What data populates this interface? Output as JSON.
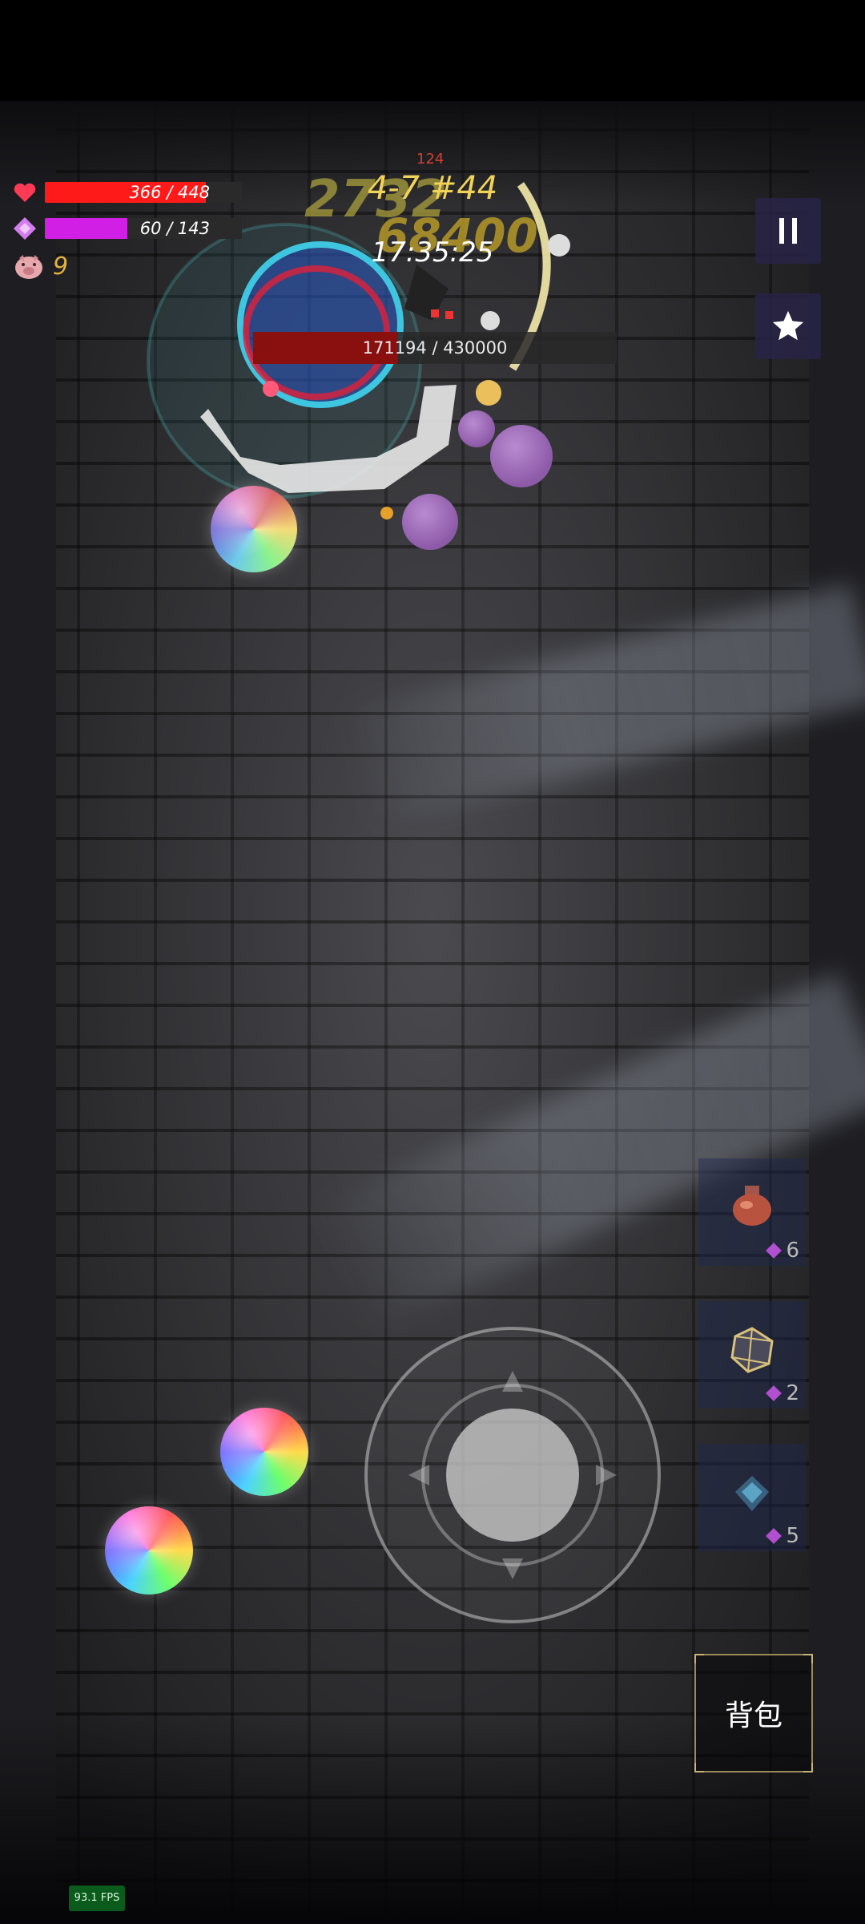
{
  "hud": {
    "hp": {
      "current": 366,
      "max": 448,
      "label": "366 / 448",
      "color": "#ff1a1a"
    },
    "mp": {
      "current": 60,
      "max": 143,
      "label": "60 / 143",
      "color": "#d21fe6"
    },
    "gold": "9"
  },
  "stage": {
    "label": "4-7 #44",
    "timer": "17:35:25"
  },
  "damage_numbers": {
    "primary": "2732",
    "secondary": "68400",
    "small": "124"
  },
  "boss": {
    "current": 171194,
    "max": 430000,
    "label": "171194 / 430000"
  },
  "buttons": {
    "pause_icon": "pause-icon",
    "favorite_icon": "star-icon",
    "bag_label": "背包"
  },
  "item_slots": [
    {
      "icon": "potion-icon",
      "count": "6"
    },
    {
      "icon": "dice-icon",
      "count": "2"
    },
    {
      "icon": "crystal-icon",
      "count": "5"
    }
  ],
  "fps": "93.1 FPS",
  "colors": {
    "gold": "#e3b23a",
    "stage": "#f2d35a",
    "boss_bar": "#8a1010"
  }
}
